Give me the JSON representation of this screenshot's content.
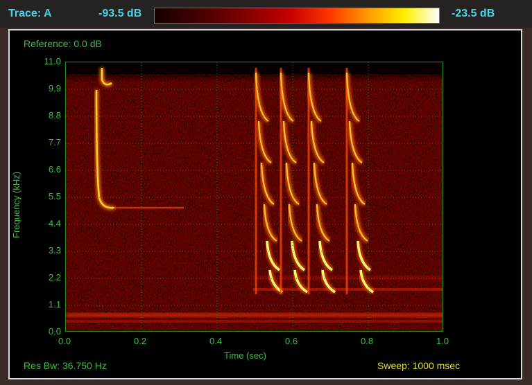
{
  "header": {
    "trace_label": "Trace: A",
    "scale_min": "-93.5 dB",
    "scale_max": "-23.5 dB"
  },
  "panel": {
    "reference": "Reference:  0.0 dB",
    "res_bw": "Res Bw:  36.750 Hz",
    "sweep": "Sweep:  1000 msec"
  },
  "axes": {
    "ylabel": "Frequency (kHz)",
    "xlabel": "Time (sec)",
    "yticks": [
      "0.0",
      "1.1",
      "2.2",
      "3.3",
      "4.4",
      "5.5",
      "6.6",
      "7.7",
      "8.8",
      "9.9",
      "11.0"
    ],
    "xticks": [
      "0.0",
      "0.2",
      "0.4",
      "0.6",
      "0.8",
      "1.0"
    ]
  },
  "colors": {
    "label_cyan": "#47d6e8",
    "label_green": "#3fbf3f",
    "label_yellow": "#e8e030",
    "grid_green": "#1f8f1f"
  }
}
